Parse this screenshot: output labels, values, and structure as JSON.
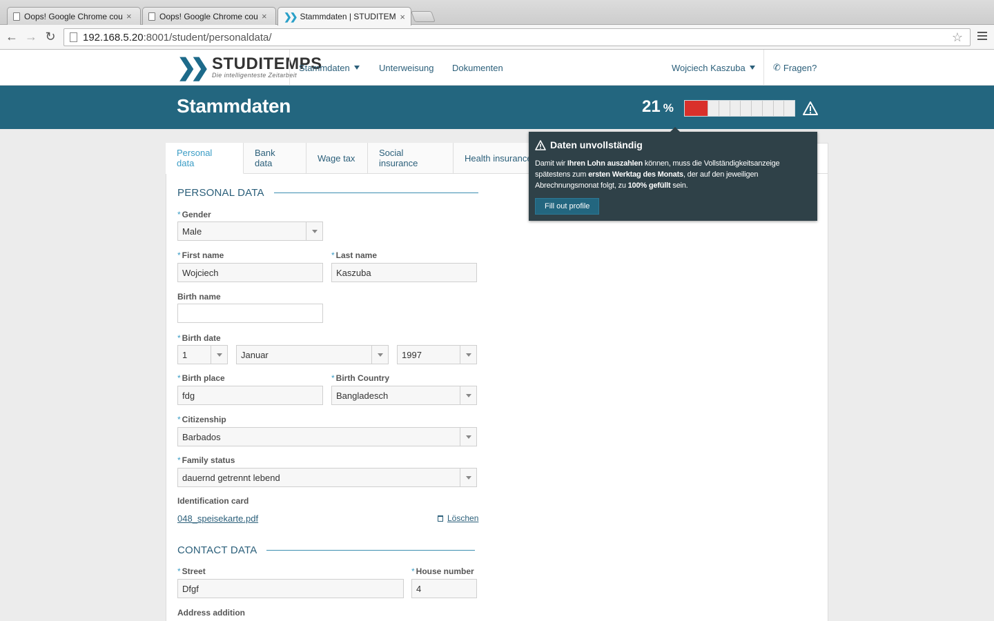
{
  "browser": {
    "tabs": [
      {
        "title": "Oops! Google Chrome cou",
        "close": "×"
      },
      {
        "title": "Oops! Google Chrome cou",
        "close": "×"
      },
      {
        "title": "Stammdaten | STUDITEMPS",
        "close": "×"
      }
    ],
    "url_host": "192.168.5.20",
    "url_path": ":8001/student/personaldata/"
  },
  "header": {
    "brand": "STUDITEMPS",
    "tagline": "Die intelligenteste Zeitarbeit",
    "nav": {
      "stammdaten": "Stammdaten",
      "unterweisung": "Unterweisung",
      "dokumente": "Dokumenten"
    },
    "user": "Wojciech Kaszuba",
    "help": "Fragen?"
  },
  "page": {
    "title": "Stammdaten",
    "completion_value": "21",
    "completion_unit": "%",
    "completion_fraction": 0.21,
    "progress_color": "#d9302b",
    "accent": "#23667f"
  },
  "tabs": [
    "Personal data",
    "Bank data",
    "Wage tax",
    "Social insurance",
    "Health insurance"
  ],
  "popover": {
    "title": "Daten unvollständig",
    "body_1": "Damit wir ",
    "body_b1": "Ihren Lohn auszahlen",
    "body_2": " können, muss die Vollständigkeitsanzeige spätestens zum ",
    "body_b2": "ersten Werktag des Monats",
    "body_3": ", der auf den jeweiligen Abrechnungsmonat folgt, zu ",
    "body_b3": "100% gefüllt",
    "body_4": " sein.",
    "button": "Fill out profile"
  },
  "personal": {
    "section": "PERSONAL DATA",
    "gender_label": "Gender",
    "gender": "Male",
    "first_name_label": "First name",
    "first_name": "Wojciech",
    "last_name_label": "Last name",
    "last_name": "Kaszuba",
    "birth_name_label": "Birth name",
    "birth_name": "",
    "birth_date_label": "Birth date",
    "birth_day": "1",
    "birth_month": "Januar",
    "birth_year": "1997",
    "birth_place_label": "Birth place",
    "birth_place": "fdg",
    "birth_country_label": "Birth Country",
    "birth_country": "Bangladesch",
    "citizenship_label": "Citizenship",
    "citizenship": "Barbados",
    "family_label": "Family status",
    "family": "dauernd getrennt lebend",
    "id_label": "Identification card",
    "id_file": "048_speisekarte.pdf",
    "delete": "Löschen"
  },
  "contact": {
    "section": "CONTACT DATA",
    "street_label": "Street",
    "street": "Dfgf",
    "house_label": "House number",
    "house": "4",
    "address_add_label": "Address addition"
  },
  "req": "*"
}
